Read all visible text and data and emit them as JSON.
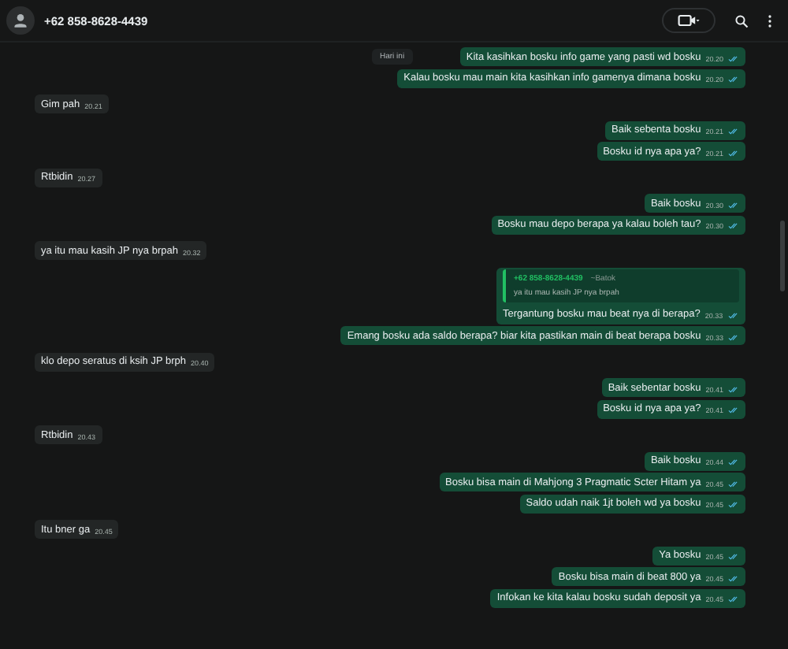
{
  "header": {
    "title": "+62 858-8628-4439"
  },
  "date_chip": "Hari ini",
  "messages": [
    {
      "outgoing": true,
      "text": "Kita kasihkan bosku info game yang pasti wd bosku",
      "time": "20.20",
      "read": true
    },
    {
      "outgoing": true,
      "text": "Kalau bosku mau main kita kasihkan info gamenya dimana bosku",
      "time": "20.20",
      "read": true
    },
    {
      "outgoing": false,
      "text": "Gim pah",
      "time": "20.21"
    },
    {
      "outgoing": true,
      "text": "Baik sebenta bosku",
      "time": "20.21",
      "read": true
    },
    {
      "outgoing": true,
      "text": "Bosku id nya apa ya?",
      "time": "20.21",
      "read": true
    },
    {
      "outgoing": false,
      "text": "Rtbidin",
      "time": "20.27"
    },
    {
      "outgoing": true,
      "text": "Baik bosku",
      "time": "20.30",
      "read": true
    },
    {
      "outgoing": true,
      "text": "Bosku mau depo berapa ya kalau boleh tau?",
      "time": "20.30",
      "read": true
    },
    {
      "outgoing": false,
      "text": "ya itu mau kasih JP nya brpah",
      "time": "20.32"
    },
    {
      "outgoing": true,
      "text": "Tergantung bosku mau beat nya di berapa?",
      "time": "20.33",
      "read": true,
      "quote": {
        "author": "+62 858-8628-4439",
        "note": "~Batok",
        "text": "ya itu mau kasih JP nya brpah"
      }
    },
    {
      "outgoing": true,
      "text": "Emang bosku ada saldo berapa? biar kita pastikan main di beat berapa bosku",
      "time": "20.33",
      "read": true
    },
    {
      "outgoing": false,
      "text": "klo depo seratus di ksih JP brph",
      "time": "20.40"
    },
    {
      "outgoing": true,
      "text": "Baik sebentar bosku",
      "time": "20.41",
      "read": true
    },
    {
      "outgoing": true,
      "text": "Bosku id nya apa ya?",
      "time": "20.41",
      "read": true
    },
    {
      "outgoing": false,
      "text": "Rtbidin",
      "time": "20.43"
    },
    {
      "outgoing": true,
      "text": "Baik bosku",
      "time": "20.44",
      "read": true
    },
    {
      "outgoing": true,
      "text": "Bosku bisa main di Mahjong 3 Pragmatic Scter Hitam ya",
      "time": "20.45",
      "read": true
    },
    {
      "outgoing": true,
      "text": "Saldo udah naik 1jt boleh wd ya bosku",
      "time": "20.45",
      "read": true
    },
    {
      "outgoing": false,
      "text": "Itu bner ga",
      "time": "20.45"
    },
    {
      "outgoing": true,
      "text": "Ya bosku",
      "time": "20.45",
      "read": true
    },
    {
      "outgoing": true,
      "text": "Bosku bisa main di beat 800 ya",
      "time": "20.45",
      "read": true
    },
    {
      "outgoing": true,
      "text": "Infokan ke kita kalau bosku sudah deposit ya",
      "time": "20.45",
      "read": true
    }
  ]
}
